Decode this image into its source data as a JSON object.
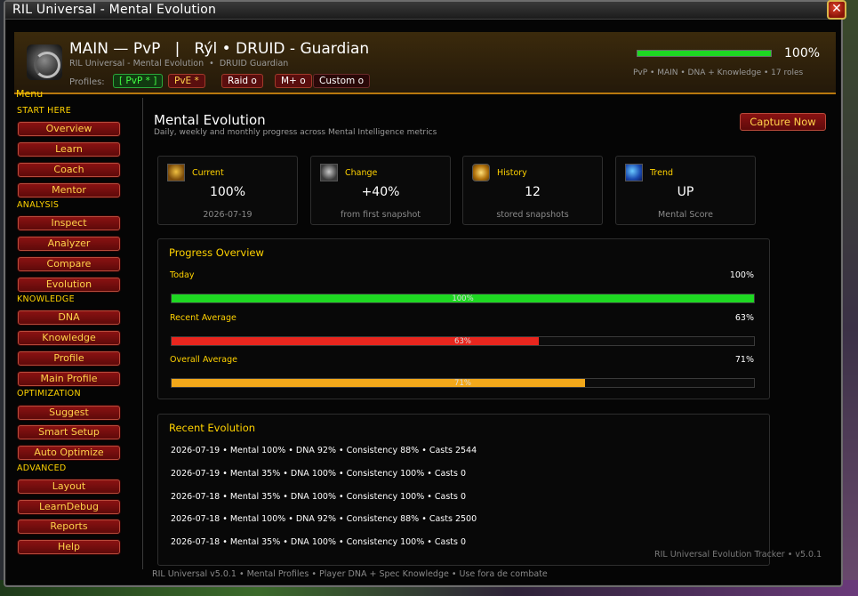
{
  "window": {
    "title": "RIL Universal - Mental Evolution",
    "close_glyph": "✕"
  },
  "header": {
    "title": "MAIN — PvP   |   Rýl • DRUID - Guardian",
    "subtitle": "RIL Universal - Mental Evolution  •  DRUID Guardian",
    "profiles_label": "Profiles:",
    "profiles": [
      "[ PvP * ]",
      "PvE *",
      "Raid o",
      "M+ o",
      "Custom o"
    ],
    "progress_pct": 100,
    "progress_label": "100%",
    "meta": "PvP • MAIN • DNA + Knowledge • 17 roles"
  },
  "sidebar": {
    "menu_title": "Menu",
    "sections": [
      {
        "title": "START HERE",
        "items": [
          "Overview",
          "Learn",
          "Coach",
          "Mentor"
        ]
      },
      {
        "title": "ANALYSIS",
        "items": [
          "Inspect",
          "Analyzer",
          "Compare",
          "Evolution"
        ]
      },
      {
        "title": "KNOWLEDGE",
        "items": [
          "DNA",
          "Knowledge",
          "Profile",
          "Main Profile"
        ]
      },
      {
        "title": "OPTIMIZATION",
        "items": [
          "Suggest",
          "Smart Setup",
          "Auto Optimize"
        ]
      },
      {
        "title": "ADVANCED",
        "items": [
          "Layout",
          "LearnDebug",
          "Reports",
          "Help"
        ]
      }
    ]
  },
  "main": {
    "title": "Mental Evolution",
    "subtitle": "Daily, weekly and monthly progress across Mental Intelligence metrics",
    "capture_label": "Capture Now",
    "cards": [
      {
        "label": "Current",
        "value": "100%",
        "sub": "2026-07-19",
        "icon": "brain-icon"
      },
      {
        "label": "Change",
        "value": "+40%",
        "sub": "from first snapshot",
        "icon": "change-icon"
      },
      {
        "label": "History",
        "value": "12",
        "sub": "stored snapshots",
        "icon": "history-icon"
      },
      {
        "label": "Trend",
        "value": "UP",
        "sub": "Mental Score",
        "icon": "trend-icon"
      }
    ],
    "progress": {
      "title": "Progress Overview",
      "rows": [
        {
          "label": "Today",
          "pct": 100,
          "pct_label": "100%",
          "bar_text": "100%",
          "color": "#1ed822"
        },
        {
          "label": "Recent Average",
          "pct": 63,
          "pct_label": "63%",
          "bar_text": "63%",
          "color": "#e8261e"
        },
        {
          "label": "Overall Average",
          "pct": 71,
          "pct_label": "71%",
          "bar_text": "71%",
          "color": "#f2a81a"
        }
      ]
    },
    "evolution": {
      "title": "Recent Evolution",
      "rows": [
        "2026-07-19  •  Mental 100%  •  DNA 92%  •  Consistency 88%  •  Casts 2544",
        "2026-07-19  •  Mental 35%  •  DNA 100%  •  Consistency 100%  •  Casts 0",
        "2026-07-18  •  Mental 35%  •  DNA 100%  •  Consistency 100%  •  Casts 0",
        "2026-07-18  •  Mental 100%  •  DNA 92%  •  Consistency 88%  •  Casts 2500",
        "2026-07-18  •  Mental 35%  •  DNA 100%  •  Consistency 100%  •  Casts 0"
      ]
    }
  },
  "footer": {
    "text": "RIL Universal v5.0.1  •  Mental Profiles  •  Player DNA + Spec Knowledge  •  Use fora de combate",
    "version": "RIL Universal Evolution Tracker  •  v5.0.1"
  }
}
